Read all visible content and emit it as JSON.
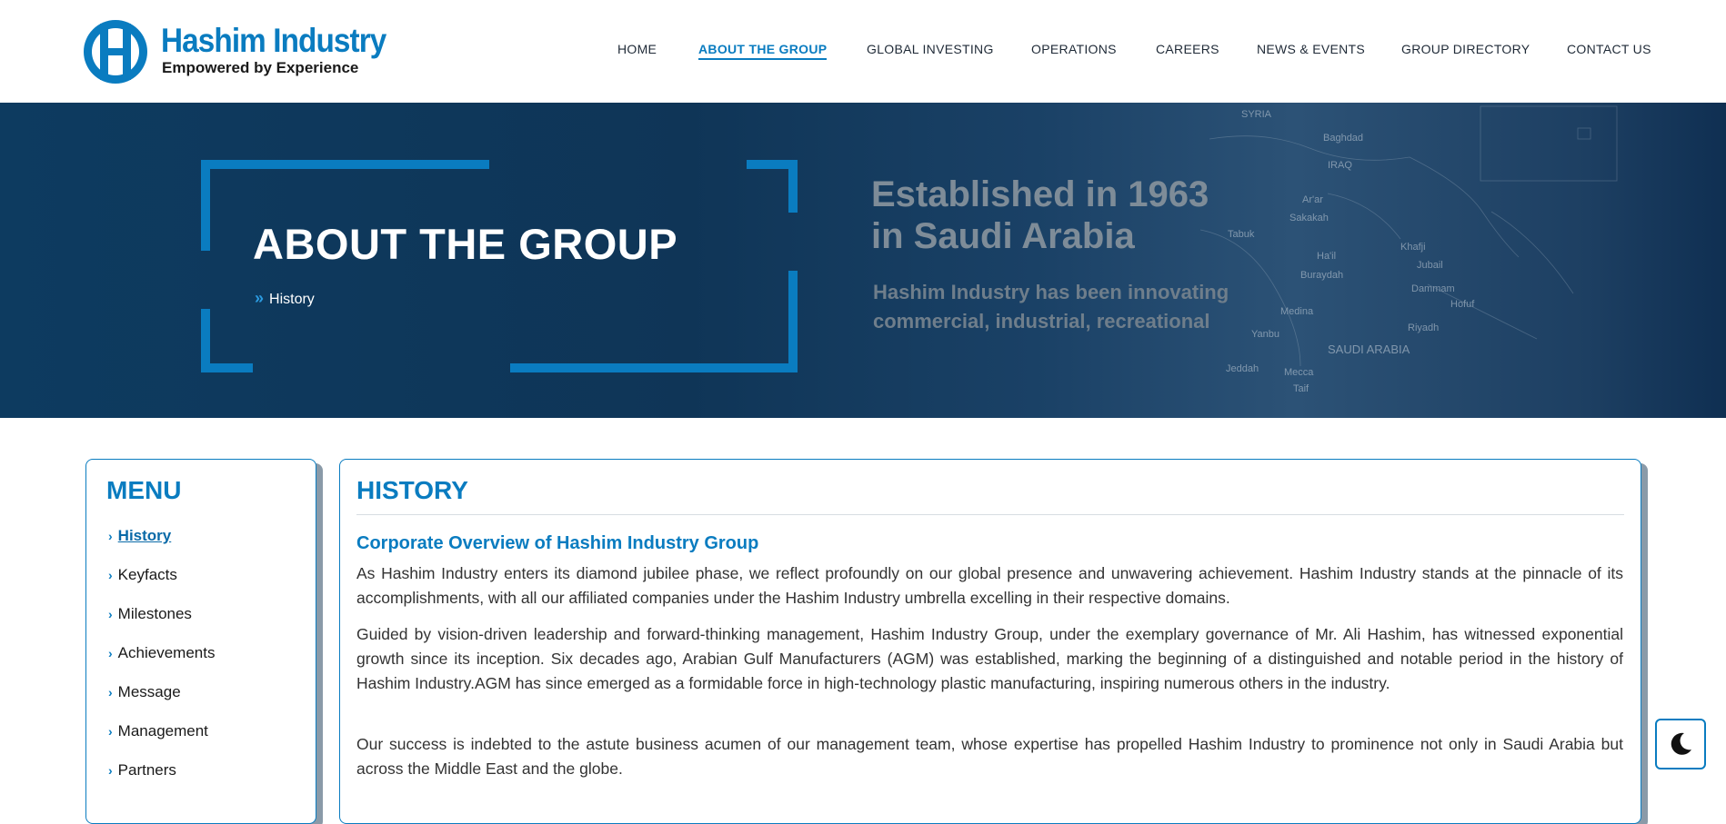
{
  "brand": {
    "name": "Hashim Industry",
    "tagline": "Empowered by Experience",
    "color": "#0a7cc0"
  },
  "nav": {
    "items": [
      {
        "label": "HOME"
      },
      {
        "label": "ABOUT THE GROUP",
        "active": true
      },
      {
        "label": "GLOBAL INVESTING"
      },
      {
        "label": "OPERATIONS"
      },
      {
        "label": "CAREERS"
      },
      {
        "label": "NEWS & EVENTS"
      },
      {
        "label": "GROUP DIRECTORY"
      },
      {
        "label": "CONTACT US"
      }
    ]
  },
  "hero": {
    "title": "ABOUT THE GROUP",
    "breadcrumb": "History",
    "bg_line1": "Established in 1963",
    "bg_line2": "in Saudi Arabia",
    "bg_line3": "Hashim Industry has been innovating",
    "bg_line4": "commercial, industrial, recreational",
    "map_labels": [
      "SYRIA",
      "Baghdad",
      "IRAQ",
      "Ar'ar",
      "Sakakah",
      "Tabuk",
      "Ha'il",
      "Buraydah",
      "Khafji",
      "Jubail",
      "Dammam",
      "Hofuf",
      "Medina",
      "Riyadh",
      "Yanbu",
      "SAUDI ARABIA",
      "Jeddah",
      "Mecca",
      "Taif"
    ]
  },
  "sidebar": {
    "title": "MENU",
    "items": [
      {
        "label": "History",
        "active": true
      },
      {
        "label": "Keyfacts"
      },
      {
        "label": "Milestones"
      },
      {
        "label": "Achievements"
      },
      {
        "label": "Message"
      },
      {
        "label": "Management"
      },
      {
        "label": "Partners"
      }
    ]
  },
  "content": {
    "title": "HISTORY",
    "subtitle": "Corporate Overview of Hashim Industry Group",
    "paragraphs": [
      "As Hashim Industry enters its diamond jubilee phase, we reflect profoundly on our global presence and unwavering achievement. Hashim Industry stands at the pinnacle of its accomplishments, with all our affiliated companies under the Hashim Industry umbrella excelling in their respective domains.",
      "Guided by vision-driven leadership and forward-thinking management, Hashim Industry Group, under the exemplary governance of Mr. Ali Hashim, has witnessed exponential growth since its inception. Six decades ago, Arabian Gulf Manufacturers (AGM) was established, marking the beginning of a distinguished and notable period in the history of Hashim Industry.AGM has since emerged as a formidable force in high-technology plastic manufacturing, inspiring numerous others in the industry.",
      "Our success is indebted to the astute business acumen of our management team, whose expertise has propelled Hashim Industry to prominence not only in Saudi Arabia but across the Middle East and the globe."
    ]
  },
  "theme_toggle": {
    "icon": "moon-icon"
  }
}
